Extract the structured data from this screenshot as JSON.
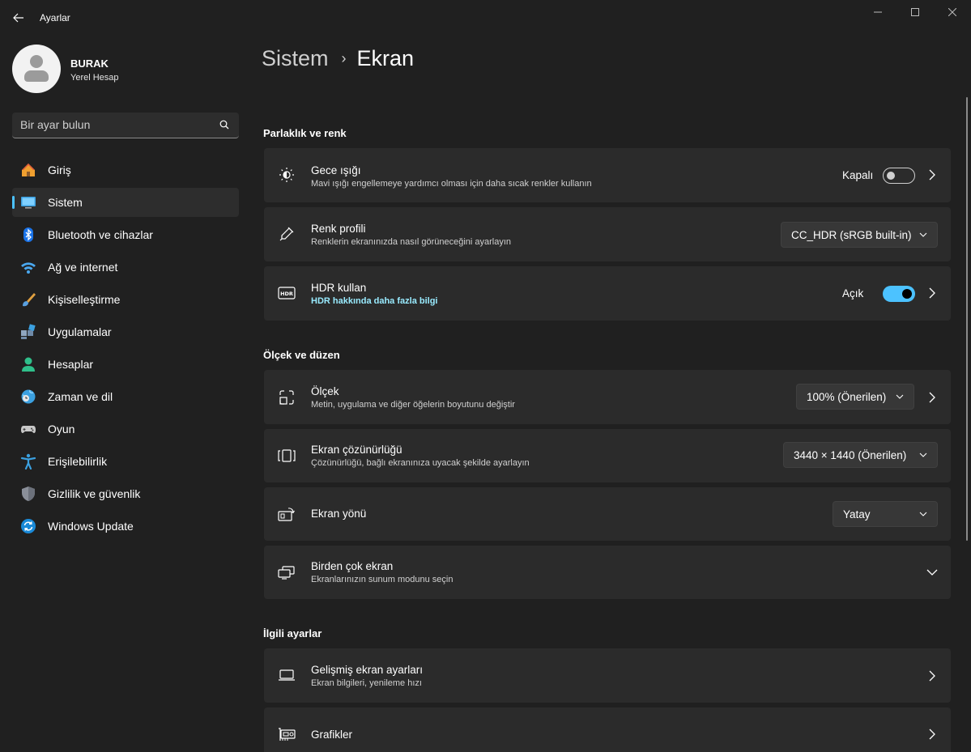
{
  "window": {
    "title": "Ayarlar"
  },
  "profile": {
    "name": "BURAK",
    "account_type": "Yerel Hesap"
  },
  "search": {
    "placeholder": "Bir ayar bulun"
  },
  "nav": {
    "items": [
      {
        "label": "Giriş",
        "icon": "home-icon"
      },
      {
        "label": "Sistem",
        "icon": "monitor-icon",
        "active": true
      },
      {
        "label": "Bluetooth ve cihazlar",
        "icon": "bluetooth-icon"
      },
      {
        "label": "Ağ ve internet",
        "icon": "wifi-icon"
      },
      {
        "label": "Kişiselleştirme",
        "icon": "brush-icon"
      },
      {
        "label": "Uygulamalar",
        "icon": "apps-icon"
      },
      {
        "label": "Hesaplar",
        "icon": "person-icon"
      },
      {
        "label": "Zaman ve dil",
        "icon": "globe-clock-icon"
      },
      {
        "label": "Oyun",
        "icon": "gamepad-icon"
      },
      {
        "label": "Erişilebilirlik",
        "icon": "accessibility-icon"
      },
      {
        "label": "Gizlilik ve güvenlik",
        "icon": "shield-icon"
      },
      {
        "label": "Windows Update",
        "icon": "update-icon"
      }
    ]
  },
  "breadcrumb": {
    "parent": "Sistem",
    "separator": "›",
    "current": "Ekran"
  },
  "sections": {
    "brightness": {
      "title": "Parlaklık ve renk",
      "night_light": {
        "title": "Gece ışığı",
        "subtitle": "Mavi ışığı engellemeye yardımcı olması için daha sıcak renkler kullanın",
        "state_label": "Kapalı",
        "on": false
      },
      "color_profile": {
        "title": "Renk profili",
        "subtitle": "Renklerin ekranınızda nasıl görüneceğini ayarlayın",
        "value": "CC_HDR (sRGB built-in)"
      },
      "hdr": {
        "title": "HDR kullan",
        "link": "HDR hakkında daha fazla bilgi",
        "state_label": "Açık",
        "on": true
      }
    },
    "scale_layout": {
      "title": "Ölçek ve düzen",
      "scale": {
        "title": "Ölçek",
        "subtitle": "Metin, uygulama ve diğer öğelerin boyutunu değiştir",
        "value": "100% (Önerilen)"
      },
      "resolution": {
        "title": "Ekran çözünürlüğü",
        "subtitle": "Çözünürlüğü, bağlı ekranınıza uyacak şekilde ayarlayın",
        "value": "3440 × 1440 (Önerilen)"
      },
      "orientation": {
        "title": "Ekran yönü",
        "value": "Yatay"
      },
      "multiple": {
        "title": "Birden çok ekran",
        "subtitle": "Ekranlarınızın sunum modunu seçin"
      }
    },
    "related": {
      "title": "İlgili ayarlar",
      "advanced": {
        "title": "Gelişmiş ekran ayarları",
        "subtitle": "Ekran bilgileri, yenileme hızı"
      },
      "graphics": {
        "title": "Grafikler"
      }
    }
  },
  "colors": {
    "accent": "#4cc2ff",
    "background": "#202020",
    "card": "#2b2b2b",
    "link": "#99ebff"
  }
}
